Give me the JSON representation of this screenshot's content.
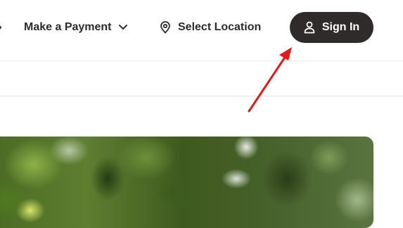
{
  "header": {
    "make_payment_label": "Make a Payment",
    "select_location_label": "Select Location",
    "sign_in_label": "Sign In"
  },
  "icons": {
    "left_cutoff": "chevron-icon",
    "payment_dropdown": "chevron-down-icon",
    "location": "map-pin-icon",
    "user": "user-icon"
  },
  "colors": {
    "sign_in_background": "#2f2b2b",
    "text": "#2b2b2b",
    "annotation_arrow": "#e11b1b"
  }
}
